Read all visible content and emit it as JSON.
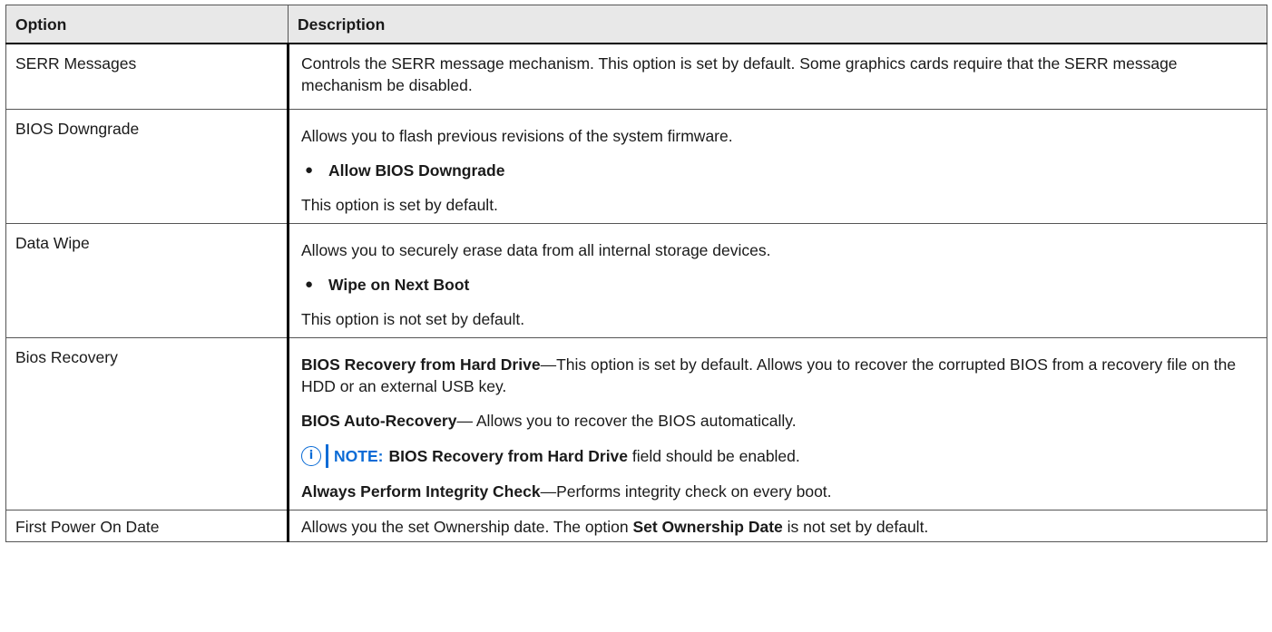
{
  "header": {
    "col1": "Option",
    "col2": "Description"
  },
  "rows": {
    "serr": {
      "option": "SERR Messages",
      "desc": "Controls the SERR message mechanism. This option is set by default. Some graphics cards require that the SERR message mechanism be disabled."
    },
    "bios_downgrade": {
      "option": "BIOS Downgrade",
      "desc": "Allows you to flash previous revisions of the system firmware.",
      "bullet": "Allow BIOS Downgrade",
      "footer": "This option is set by default."
    },
    "data_wipe": {
      "option": "Data Wipe",
      "desc": "Allows you to securely erase data from all internal storage devices.",
      "bullet": "Wipe on Next Boot",
      "footer": "This option is not set by default."
    },
    "bios_recovery": {
      "option": "Bios Recovery",
      "p1_bold": "BIOS Recovery from Hard Drive",
      "p1_text": "—This option is set by default. Allows you to recover the corrupted BIOS from a recovery file on the HDD or an external USB key.",
      "p2_bold": "BIOS Auto-Recovery",
      "p2_text": "— Allows you to recover the BIOS automatically.",
      "note_label": "NOTE:",
      "note_bold": "BIOS Recovery from Hard Drive",
      "note_text": " field should be enabled.",
      "p3_bold": "Always Perform Integrity Check",
      "p3_text": "—Performs integrity check on every boot."
    },
    "first_power": {
      "option": "First Power On Date",
      "desc_pre": "Allows you the set Ownership date. The option ",
      "desc_bold": "Set Ownership Date",
      "desc_post": " is not set by default."
    }
  },
  "icons": {
    "note_icon": "i",
    "bullet_icon": "●"
  },
  "colors": {
    "accent": "#0a6bd6",
    "header_bg": "#e8e8e8"
  }
}
